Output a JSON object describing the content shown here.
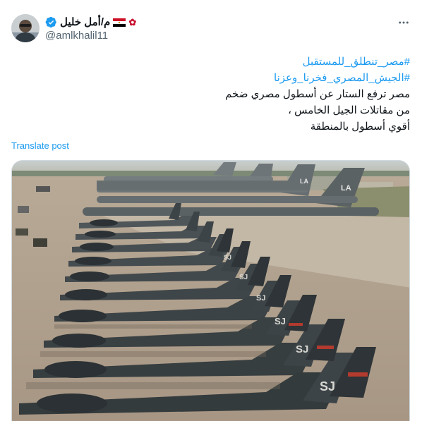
{
  "author": {
    "display_name": "م/أمل خليل",
    "handle": "@amlkhalil11",
    "verified": true,
    "avatar_icon": "avatar-photo",
    "decorations": [
      "egypt-flag-icon",
      "rose-icon"
    ]
  },
  "post": {
    "hashtags": [
      "#مصر_تنطلق_للمستقبل",
      "#الجيش_المصري_فخرنا_وعزنا"
    ],
    "lines": [
      "مصر ترفع الستار عن أسطول مصري ضخم",
      "من مقاتلات الجيل الخامس ،",
      "أقوي أسطول بالمنطقة"
    ],
    "translate_label": "Translate post"
  },
  "media": {
    "tail_codes": [
      "LA",
      "LA",
      "SJ",
      "SJ",
      "SJ",
      "SJ",
      "SJ",
      "SJ"
    ]
  },
  "colors": {
    "link": "#1d9bf0",
    "secondary": "#536471",
    "verified": "#1d9bf0"
  }
}
